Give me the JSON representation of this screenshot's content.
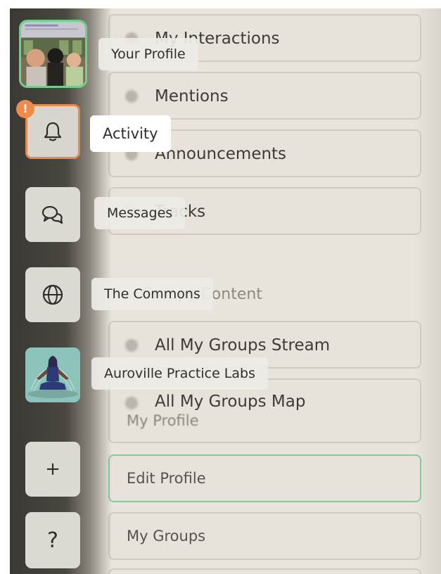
{
  "background_panel": {
    "items": [
      {
        "label": "My Interactions"
      },
      {
        "label": "Mentions"
      },
      {
        "label": "Announcements"
      },
      {
        "label": "Tracks"
      }
    ],
    "section_header": "Groups Content",
    "group_items": [
      {
        "label": "All My Groups Stream"
      },
      {
        "label": "All My Groups Map"
      }
    ],
    "profile_section_header": "My Profile",
    "profile_items": [
      {
        "label": "Edit Profile"
      },
      {
        "label": "My Groups"
      }
    ]
  },
  "sidebar": {
    "profile_tooltip": "Your Profile",
    "activity_tooltip": "Activity",
    "activity_badge": "!",
    "messages_tooltip": "Messages",
    "commons_tooltip": "The Commons",
    "auroville_tooltip": "Auroville Practice Labs",
    "add_label": "+",
    "help_label": "?"
  },
  "colors": {
    "active_border": "#7fcf9c",
    "profile_border": "#6fcf8f",
    "activity_border": "#e58a4f",
    "badge": "#ee8b4a"
  }
}
